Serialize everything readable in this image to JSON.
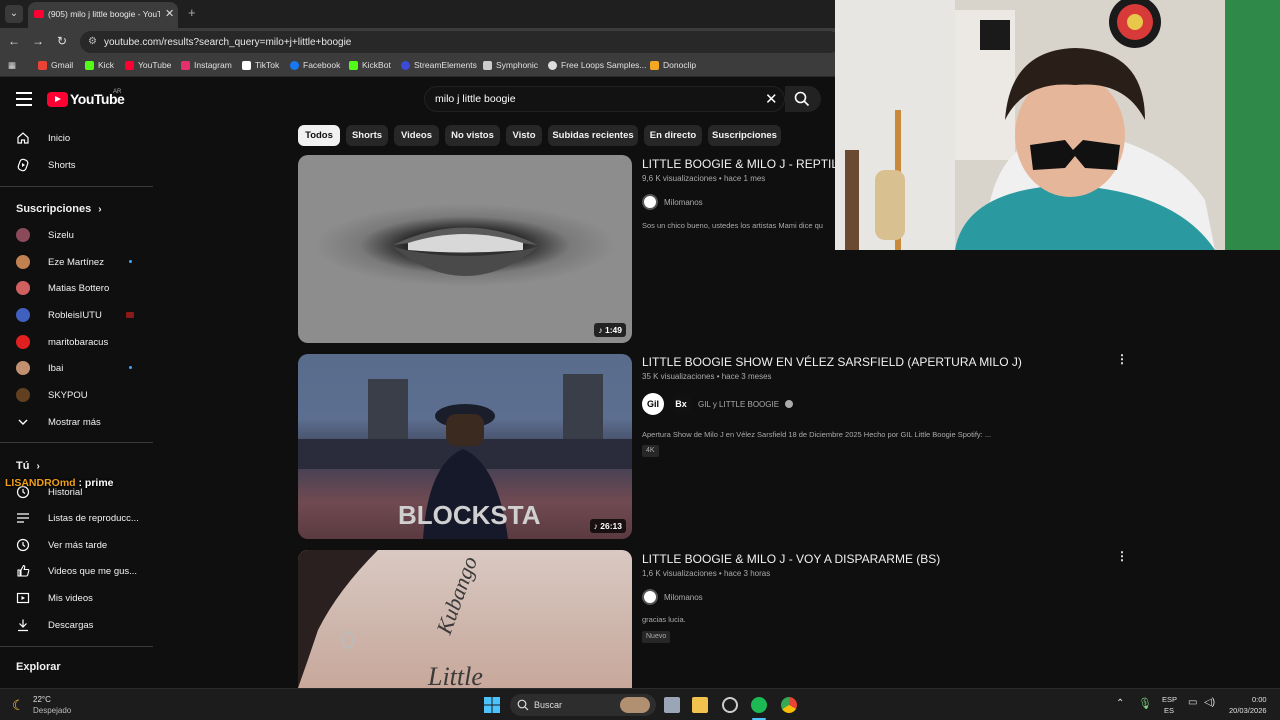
{
  "browser": {
    "tab_title": "(905) milo j little boogie - YouTube",
    "url": "youtube.com/results?search_query=milo+j+little+boogie",
    "bookmarks": [
      {
        "label": "Gmail",
        "color": "#ea4335"
      },
      {
        "label": "Kick",
        "color": "#53fc18"
      },
      {
        "label": "YouTube",
        "color": "#ff0033"
      },
      {
        "label": "Instagram",
        "color": "#e1306c"
      },
      {
        "label": "TikTok",
        "color": "#ffffff"
      },
      {
        "label": "Facebook",
        "color": "#1877f2"
      },
      {
        "label": "KickBot",
        "color": "#53fc18"
      },
      {
        "label": "StreamElements",
        "color": "#3b4bd8"
      },
      {
        "label": "Symphonic",
        "color": "#cccccc"
      },
      {
        "label": "Free Loops Samples...",
        "color": "#dddddd"
      },
      {
        "label": "Donoclip",
        "color": "#f5a623"
      }
    ]
  },
  "header": {
    "logo_text": "YouTube",
    "country": "AR",
    "search_value": "milo j little boogie"
  },
  "sidebar": {
    "main": [
      {
        "label": "Inicio",
        "icon": "home-icon"
      },
      {
        "label": "Shorts",
        "icon": "shorts-icon"
      }
    ],
    "subs_heading": "Suscripciones",
    "subs": [
      {
        "label": "Sizelu",
        "color": "#8a4a5a",
        "live": false
      },
      {
        "label": "Eze Martínez",
        "color": "#c08050",
        "live": true
      },
      {
        "label": "Matias Bottero",
        "color": "#d06060",
        "live": false
      },
      {
        "label": "RobleisIUTU",
        "color": "#4060c0",
        "live": false,
        "red": true
      },
      {
        "label": "maritobaracus",
        "color": "#e02020",
        "live": false
      },
      {
        "label": "Ibai",
        "color": "#c09070",
        "live": true
      },
      {
        "label": "SKYPOU",
        "color": "#604020",
        "live": false
      }
    ],
    "show_more": "Mostrar más",
    "you_heading": "Tú",
    "you": [
      {
        "label": "Historial",
        "icon": "history-icon"
      },
      {
        "label": "Listas de reproducc...",
        "icon": "playlists-icon"
      },
      {
        "label": "Ver más tarde",
        "icon": "watch-later-icon"
      },
      {
        "label": "Videos que me gus...",
        "icon": "like-icon"
      },
      {
        "label": "Mis videos",
        "icon": "my-videos-icon"
      },
      {
        "label": "Descargas",
        "icon": "download-icon"
      }
    ],
    "explore_heading": "Explorar"
  },
  "chips": [
    "Todos",
    "Shorts",
    "Videos",
    "No vistos",
    "Visto",
    "Subidas recientes",
    "En directo",
    "Suscripciones"
  ],
  "results": [
    {
      "title": "LITTLE BOOGIE & MILO J - REPTILIA",
      "meta": "9,6 K visualizaciones • hace 1 mes",
      "channel": "Milomanos",
      "desc": "Sos un chico bueno, ustedes los artistas Mami dice qu",
      "duration": "1:49"
    },
    {
      "title": "LITTLE BOOGIE SHOW EN VÉLEZ SARSFIELD (APERTURA MILO J)",
      "meta": "35 K visualizaciones • hace 3 meses",
      "channel": "GIL y LITTLE BOOGIE",
      "desc": "Apertura Show de Milo J en Vélez Sarsfield 18 de Diciembre 2025 Hecho por GIL Little Boogie Spotify: ...",
      "badge": "4K",
      "duration": "26:13"
    },
    {
      "title": "LITTLE BOOGIE & MILO J - VOY A DISPARARME (BS)",
      "meta": "1,6 K visualizaciones • hace 3 horas",
      "channel": "Milomanos",
      "desc": "gracias lucia.",
      "badge": "Nuevo"
    }
  ],
  "chat": {
    "user": "LISANDROmd",
    "message": ": prime"
  },
  "taskbar": {
    "weather_temp": "22°C",
    "weather_desc": "Despejado",
    "search_label": "Buscar",
    "lang_top": "ESP",
    "lang_bottom": "ES",
    "time": "0:00",
    "date": "20/03/2026"
  }
}
